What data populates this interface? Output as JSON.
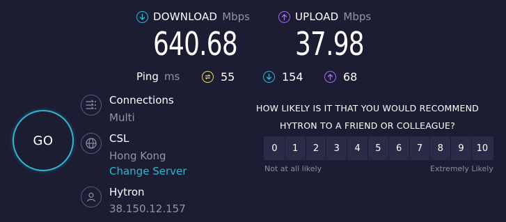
{
  "download": {
    "label": "DOWNLOAD",
    "unit": "Mbps",
    "value": "640.68",
    "icon": "download-arrow-icon",
    "color": "#2fb6d0"
  },
  "upload": {
    "label": "UPLOAD",
    "unit": "Mbps",
    "value": "37.98",
    "icon": "upload-arrow-icon",
    "color": "#a36be8"
  },
  "ping": {
    "label": "Ping",
    "unit": "ms",
    "idle": {
      "value": "55",
      "icon": "idle-latency-icon",
      "color": "#f2d85a"
    },
    "download": {
      "value": "154",
      "icon": "download-latency-icon",
      "color": "#2fb6d0"
    },
    "upload": {
      "value": "68",
      "icon": "upload-latency-icon",
      "color": "#a36be8"
    }
  },
  "go_button": {
    "label": "GO",
    "color": "#2fb6d0"
  },
  "connections": {
    "title": "Connections",
    "value": "Multi",
    "icon": "connections-icon"
  },
  "server": {
    "title": "CSL",
    "location": "Hong Kong",
    "change_label": "Change Server",
    "icon": "globe-icon"
  },
  "provider": {
    "title": "Hytron",
    "ip": "38.150.12.157",
    "icon": "user-icon"
  },
  "nps": {
    "question_line1": "HOW LIKELY IS IT THAT YOU WOULD RECOMMEND",
    "question_line2": "HYTRON TO A FRIEND OR COLLEAGUE?",
    "scale": [
      "0",
      "1",
      "2",
      "3",
      "4",
      "5",
      "6",
      "7",
      "8",
      "9",
      "10"
    ],
    "low_label": "Not at all likely",
    "high_label": "Extremely Likely"
  }
}
